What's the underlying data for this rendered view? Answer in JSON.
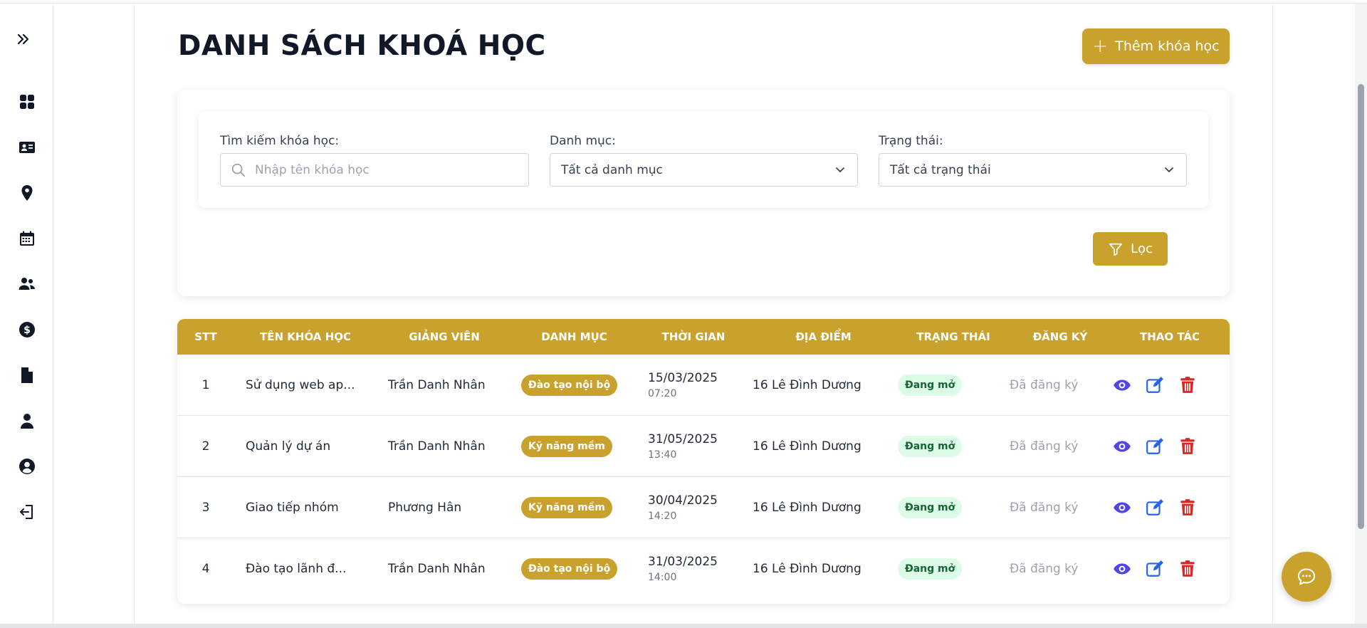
{
  "page": {
    "title": "DANH SÁCH KHOÁ HỌC",
    "add_button_label": "Thêm khóa học"
  },
  "sidebar": {
    "icons": [
      "expand-icon",
      "dashboard-icon",
      "id-card-icon",
      "location-icon",
      "calendar-icon",
      "users-icon",
      "dollar-icon",
      "file-icon",
      "user-icon",
      "user-circle-icon",
      "logout-icon"
    ]
  },
  "filters": {
    "search_label": "Tìm kiếm khóa học:",
    "search_placeholder": "Nhập tên khóa học",
    "category_label": "Danh mục:",
    "category_value": "Tất cả danh mục",
    "status_label": "Trạng thái:",
    "status_value": "Tất cả trạng thái",
    "filter_button_label": "Lọc"
  },
  "table": {
    "headers": [
      "STT",
      "TÊN KHÓA HỌC",
      "GIẢNG VIÊN",
      "DANH MỤC",
      "THỜI GIAN",
      "ĐỊA ĐIỂM",
      "TRẠNG THÁI",
      "ĐĂNG KÝ",
      "THAO TÁC"
    ],
    "rows": [
      {
        "stt": "1",
        "name": "Sử dụng web ap...",
        "teacher": "Trần Danh Nhân",
        "category": "Đào tạo nội bộ",
        "date": "15/03/2025",
        "time": "07:20",
        "location": "16 Lê Đình Dương",
        "status": "Đang mở",
        "registration": "Đã đăng ký"
      },
      {
        "stt": "2",
        "name": "Quản lý dự án",
        "teacher": "Trần Danh Nhân",
        "category": "Kỹ năng mềm",
        "date": "31/05/2025",
        "time": "13:40",
        "location": "16 Lê Đình Dương",
        "status": "Đang mở",
        "registration": "Đã đăng ký"
      },
      {
        "stt": "3",
        "name": "Giao tiếp nhóm",
        "teacher": "Phương Hân",
        "category": "Kỹ năng mềm",
        "date": "30/04/2025",
        "time": "14:20",
        "location": "16 Lê Đình Dương",
        "status": "Đang mở",
        "registration": "Đã đăng ký"
      },
      {
        "stt": "4",
        "name": "Đào tạo lãnh đ...",
        "teacher": "Trần Danh Nhân",
        "category": "Đào tạo nội bộ",
        "date": "31/03/2025",
        "time": "14:00",
        "location": "16 Lê Đình Dương",
        "status": "Đang mở",
        "registration": "Đã đăng ký"
      }
    ]
  },
  "colors": {
    "accent": "#c9a22e",
    "view": "#4f46e5",
    "edit": "#2563eb",
    "delete": "#dc2626",
    "status_bg": "#dcfce7",
    "status_text": "#166534"
  }
}
